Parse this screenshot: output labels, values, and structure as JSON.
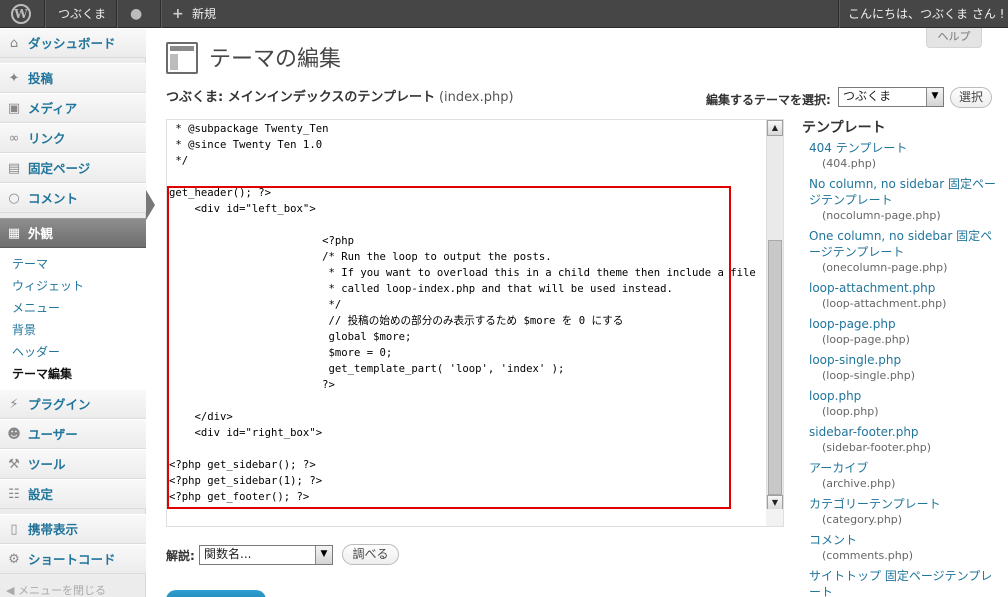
{
  "adminbar": {
    "site_name": "つぶくま",
    "new_label": "新規",
    "greeting": "こんにちは、つぶくま さん !"
  },
  "sidebar": {
    "items": [
      {
        "label": "ダッシュボード",
        "icon": "dashboard-icon"
      },
      {
        "label": "投稿",
        "icon": "pin-icon"
      },
      {
        "label": "メディア",
        "icon": "media-icon"
      },
      {
        "label": "リンク",
        "icon": "link-icon"
      },
      {
        "label": "固定ページ",
        "icon": "page-icon"
      },
      {
        "label": "コメント",
        "icon": "comment-icon"
      },
      {
        "label": "外観",
        "icon": "appearance-icon"
      },
      {
        "label": "プラグイン",
        "icon": "plugin-icon"
      },
      {
        "label": "ユーザー",
        "icon": "users-icon"
      },
      {
        "label": "ツール",
        "icon": "tools-icon"
      },
      {
        "label": "設定",
        "icon": "settings-icon"
      },
      {
        "label": "携帯表示",
        "icon": "mobile-icon"
      },
      {
        "label": "ショートコード",
        "icon": "shortcode-icon"
      }
    ],
    "submenu": [
      "テーマ",
      "ウィジェット",
      "メニュー",
      "背景",
      "ヘッダー",
      "テーマ編集"
    ],
    "collapse_label": "メニューを閉じる"
  },
  "help_label": "ヘルプ",
  "page_title": "テーマの編集",
  "file_title": "つぶくま: メインインデックスのテンプレート",
  "file_name": "(index.php)",
  "theme_select": {
    "label": "編集するテーマを選択:",
    "value": "つぶくま",
    "button": "選択"
  },
  "code_lines": [
    " * @subpackage Twenty_Ten",
    " * @since Twenty Ten 1.0",
    " */",
    "",
    "get_header(); ?>",
    "    <div id=\"left_box\">",
    "",
    "                        <?php",
    "                        /* Run the loop to output the posts.",
    "                         * If you want to overload this in a child theme then include a file",
    "                         * called loop-index.php and that will be used instead.",
    "                         */",
    "                         // 投稿の始めの部分のみ表示するため $more を 0 にする",
    "                         global $more;",
    "                         $more = 0;",
    "                         get_template_part( 'loop', 'index' );",
    "                        ?>",
    "",
    "    </div>",
    "    <div id=\"right_box\">",
    "",
    "<?php get_sidebar(); ?>",
    "<?php get_sidebar(1); ?>",
    "<?php get_footer(); ?>"
  ],
  "documentation": {
    "label": "解説:",
    "select_value": "関数名...",
    "button": "調べる"
  },
  "templates": {
    "heading": "テンプレート",
    "items": [
      {
        "name": "404 テンプレート",
        "file": "(404.php)"
      },
      {
        "name": "No column, no sidebar 固定ページテンプレート",
        "file": "(nocolumn-page.php)"
      },
      {
        "name": "One column, no sidebar 固定ページテンプレート",
        "file": "(onecolumn-page.php)"
      },
      {
        "name": "loop-attachment.php",
        "file": "(loop-attachment.php)"
      },
      {
        "name": "loop-page.php",
        "file": "(loop-page.php)"
      },
      {
        "name": "loop-single.php",
        "file": "(loop-single.php)"
      },
      {
        "name": "loop.php",
        "file": "(loop.php)"
      },
      {
        "name": "sidebar-footer.php",
        "file": "(sidebar-footer.php)"
      },
      {
        "name": "アーカイブ",
        "file": "(archive.php)"
      },
      {
        "name": "カテゴリーテンプレート",
        "file": "(category.php)"
      },
      {
        "name": "コメント",
        "file": "(comments.php)"
      },
      {
        "name": "サイトトップ 固定ページテンプレート",
        "file": ""
      }
    ]
  }
}
